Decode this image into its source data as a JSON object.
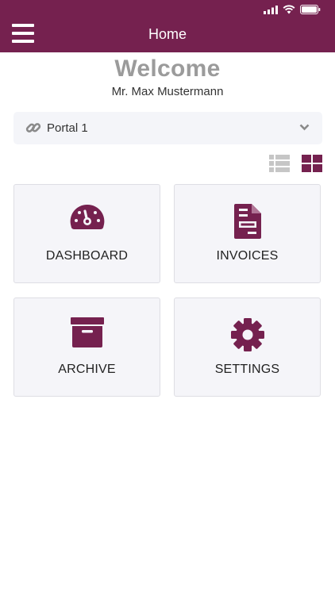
{
  "header": {
    "title": "Home"
  },
  "welcome": {
    "heading": "Welcome",
    "user_name": "Mr. Max Mustermann"
  },
  "portal_select": {
    "selected": "Portal 1"
  },
  "tiles": [
    {
      "label": "DASHBOARD",
      "icon": "speedometer-icon"
    },
    {
      "label": "INVOICES",
      "icon": "invoice-document-icon"
    },
    {
      "label": "ARCHIVE",
      "icon": "archive-box-icon"
    },
    {
      "label": "SETTINGS",
      "icon": "gear-icon"
    }
  ],
  "colors": {
    "brand": "#75214f",
    "tile_bg": "#f5f5f9",
    "muted": "#9b9b9b"
  }
}
